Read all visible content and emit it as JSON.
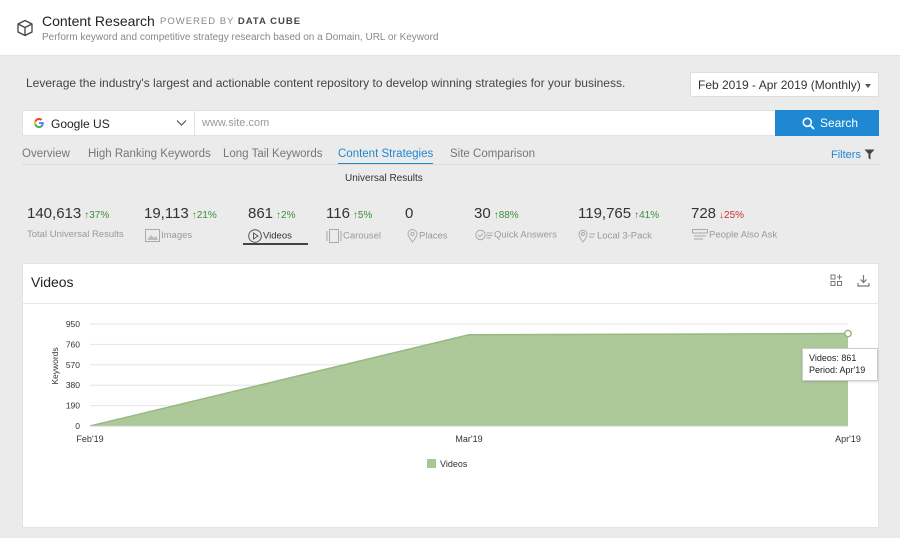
{
  "header": {
    "title": "Content Research",
    "powered_prefix": "POWERED BY",
    "powered_brand": "DATA CUBE",
    "subtitle": "Perform keyword and competitive strategy research based on a Domain, URL or Keyword"
  },
  "banner": {
    "text": "Leverage the industry's largest and actionable content repository to develop winning strategies for your business.",
    "date_range": "Feb 2019 - Apr 2019 (Monthly)"
  },
  "search": {
    "engine": "Google US",
    "placeholder": "www.site.com",
    "button": "Search"
  },
  "tabs": {
    "items": [
      "Overview",
      "High Ranking Keywords",
      "Long Tail Keywords",
      "Content Strategies",
      "Site Comparison"
    ],
    "active_index": 3,
    "filters": "Filters"
  },
  "sub_label": "Universal Results",
  "metrics": [
    {
      "value": "140,613",
      "change": "↑37%",
      "direction": "up",
      "label": "Total Universal Results",
      "icon": ""
    },
    {
      "value": "19,113",
      "change": "↑21%",
      "direction": "up",
      "label": "Images",
      "icon": "image-icon"
    },
    {
      "value": "861",
      "change": "↑2%",
      "direction": "up",
      "label": "Videos",
      "icon": "play-icon"
    },
    {
      "value": "116",
      "change": "↑5%",
      "direction": "up",
      "label": "Carousel",
      "icon": "carousel-icon"
    },
    {
      "value": "0",
      "change": "",
      "direction": "",
      "label": "Places",
      "icon": "pin-icon"
    },
    {
      "value": "30",
      "change": "↑88%",
      "direction": "up",
      "label": "Quick Answers",
      "icon": "quick-answer-icon"
    },
    {
      "value": "119,765",
      "change": "↑41%",
      "direction": "up",
      "label": "Local 3-Pack",
      "icon": "local-pin-icon"
    },
    {
      "value": "728",
      "change": "↓25%",
      "direction": "down",
      "label": "People Also Ask",
      "icon": "paa-icon"
    }
  ],
  "card": {
    "title": "Videos",
    "tooltip_line1": "Videos: 861",
    "tooltip_line2": "Period: Apr'19"
  },
  "chart_data": {
    "type": "area",
    "categories": [
      "Feb'19",
      "Mar'19",
      "Apr'19"
    ],
    "series": [
      {
        "name": "Videos",
        "values": [
          0,
          850,
          861
        ],
        "color": "#a9c695"
      }
    ],
    "ylabel": "Keywords",
    "yticks": [
      0,
      190,
      380,
      570,
      760,
      950
    ],
    "ylim": [
      0,
      950
    ],
    "grid": true,
    "legend": "bottom-center"
  },
  "colors": {
    "accent": "#1e88d2",
    "up": "#3b8f3b",
    "down": "#d03030",
    "area": "#a9c695"
  }
}
